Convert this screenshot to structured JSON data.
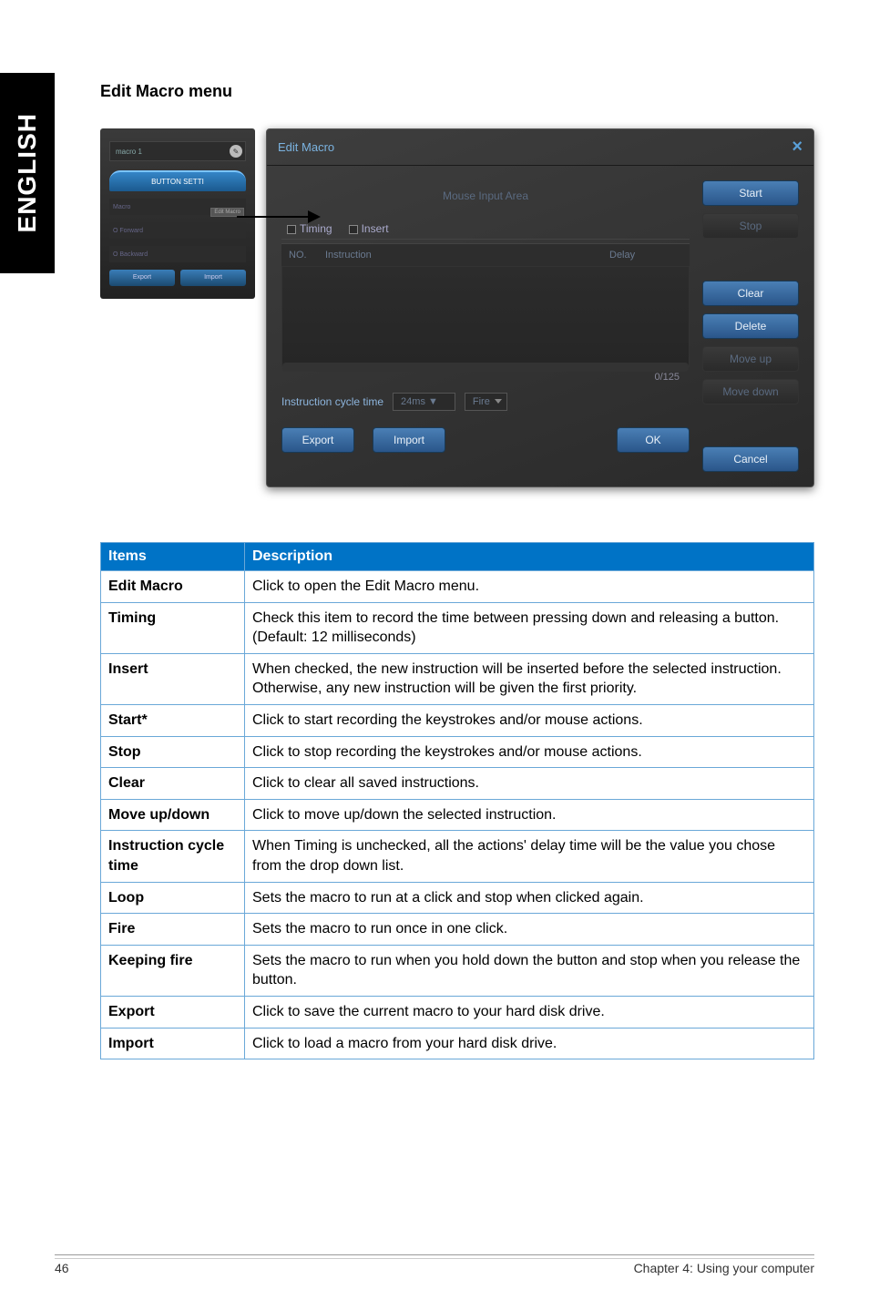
{
  "side_tab": "ENGLISH",
  "section_title": "Edit Macro menu",
  "left_panel": {
    "row_label": "macro 1",
    "btn_setting": "BUTTON SETTI",
    "sub1": "Macro",
    "sub1_badge": "Edit Macro",
    "sub2": "O Forward",
    "sub3": "O Backward",
    "foot1": "Export",
    "foot2": "Import"
  },
  "dialog": {
    "title": "Edit Macro",
    "mouse_area": "Mouse Input Area",
    "tab_timing": "Timing",
    "tab_insert": "Insert",
    "col_no": "NO.",
    "col_instr": "Instruction",
    "col_delay": "Delay",
    "counter": "0/125",
    "cycle_label": "Instruction cycle time",
    "cycle_val": "24ms ▼",
    "fire_val": "Fire",
    "btn_export": "Export",
    "btn_import": "Import",
    "btn_ok": "OK",
    "btn_start": "Start",
    "btn_stop": "Stop",
    "btn_clear": "Clear",
    "btn_delete": "Delete",
    "btn_moveup": "Move up",
    "btn_movedown": "Move down",
    "btn_cancel": "Cancel"
  },
  "table": {
    "h1": "Items",
    "h2": "Description",
    "rows": [
      {
        "k": "Edit Macro",
        "v": "Click to open the Edit Macro menu."
      },
      {
        "k": "Timing",
        "v": "Check this item to record the time between pressing down and releasing a button. (Default: 12 milliseconds)"
      },
      {
        "k": "Insert",
        "v": "When checked, the new instruction will be inserted before the selected instruction. Otherwise, any new instruction will be given the first priority."
      },
      {
        "k": "Start*",
        "v": "Click to start recording the keystrokes and/or mouse actions."
      },
      {
        "k": "Stop",
        "v": "Click to stop recording the keystrokes and/or mouse actions."
      },
      {
        "k": "Clear",
        "v": "Click to clear all saved instructions."
      },
      {
        "k": "Move up/down",
        "v": "Click to move up/down the selected instruction."
      },
      {
        "k": "Instruction cycle time",
        "v": "When Timing is unchecked, all the actions' delay time will be the value you chose from the drop down list."
      },
      {
        "k": "Loop",
        "v": "Sets the macro to run at a click and stop when clicked again."
      },
      {
        "k": "Fire",
        "v": "Sets the macro to run once in one click."
      },
      {
        "k": "Keeping fire",
        "v": "Sets the macro to run when you hold down the button and stop when you release the button."
      },
      {
        "k": "Export",
        "v": "Click to save the current macro to your hard disk drive."
      },
      {
        "k": "Import",
        "v": "Click to load a macro from your hard disk drive."
      }
    ]
  },
  "footer": {
    "page": "46",
    "chapter": "Chapter 4: Using your computer"
  }
}
